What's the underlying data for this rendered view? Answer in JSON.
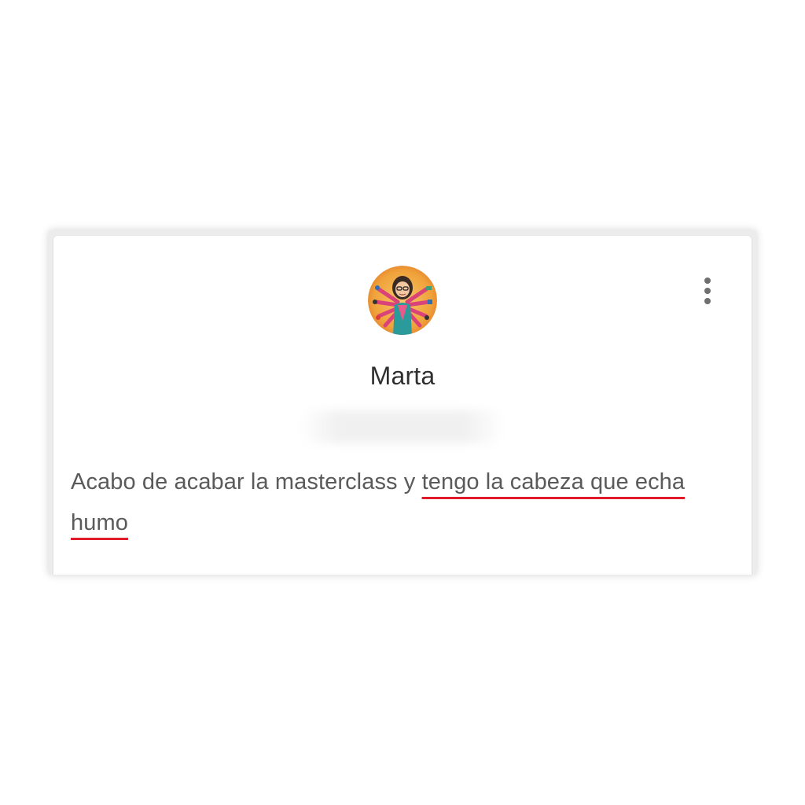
{
  "user": {
    "name": "Marta",
    "avatar_icon": "profile-avatar-multi-armed-woman"
  },
  "menu": {
    "icon": "more-vert-icon"
  },
  "comment": {
    "before": "Acabo de acabar la masterclass y ",
    "highlighted": "tengo la cabeza que echa humo"
  },
  "colors": {
    "highlight_underline": "#e21b2a",
    "text": "#5a5a5a",
    "name": "#2f2f2f"
  }
}
